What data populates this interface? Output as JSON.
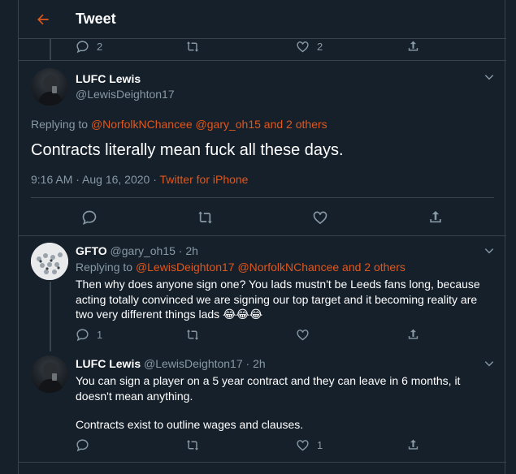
{
  "header": {
    "title": "Tweet"
  },
  "prev_tweet": {
    "reply_count": "2",
    "like_count": "2"
  },
  "main_tweet": {
    "display_name": "LUFC Lewis",
    "handle": "@LewisDeighton17",
    "replying_label": "Replying to",
    "replying_to": "@NorfolkNChancee @gary_oh15 and 2 others",
    "text": "Contracts literally mean fuck all these days.",
    "timestamp": "9:16 AM · Aug 16, 2020 · ",
    "source": "Twitter for iPhone"
  },
  "reply1": {
    "display_name": "GFTO",
    "meta": "@gary_oh15 · 2h",
    "replying_label": "Replying to",
    "replying_to": "@LewisDeighton17 @NorfolkNChancee and 2 others",
    "line1": "Then why does anyone sign one? You lads mustn't be Leeds fans long, because",
    "line2": "acting totally convinced we are signing our top target and it becoming reality are",
    "line3": "two very different things lads",
    "emojis": "😂😂😂",
    "reply_count": "1"
  },
  "reply2": {
    "display_name": "LUFC Lewis",
    "meta": "@LewisDeighton17 · 2h",
    "line1": "You can sign a player on a 5 year contract and they can leave in 6 months, it",
    "line2": "doesn't mean anything.",
    "line3": "Contracts exist to outline wages and clauses.",
    "like_count": "1"
  },
  "colors": {
    "background": "#15202b",
    "accent": "#e0571d",
    "muted": "#8899a6",
    "border": "#38444d"
  }
}
